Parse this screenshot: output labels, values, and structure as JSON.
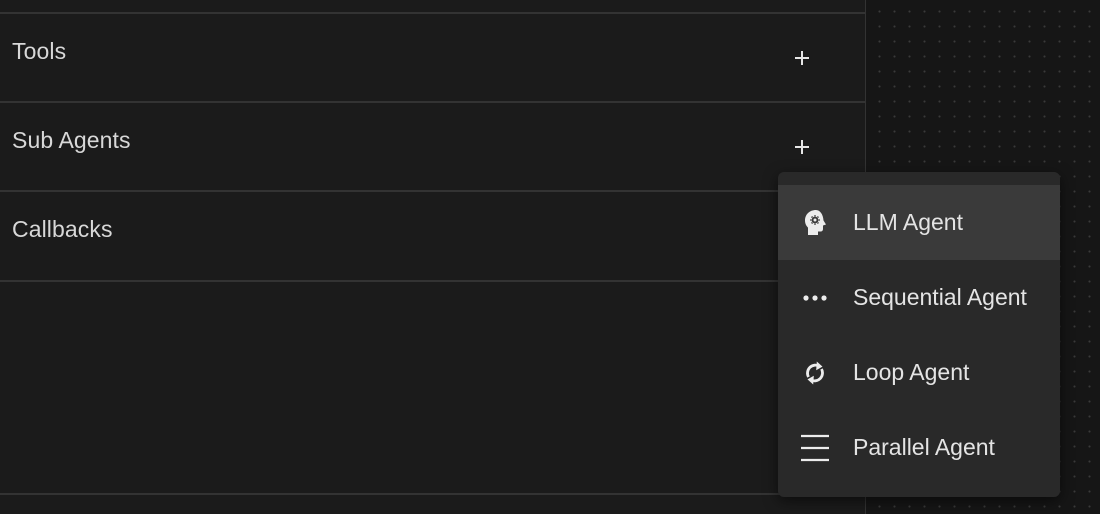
{
  "sections": {
    "tools": {
      "title": "Tools",
      "add_icon": "plus-icon"
    },
    "sub_agents": {
      "title": "Sub Agents",
      "add_icon": "plus-icon"
    },
    "callbacks": {
      "title": "Callbacks"
    }
  },
  "agent_menu": {
    "items": [
      {
        "label": "LLM Agent",
        "icon": "psychology-head-icon",
        "highlighted": true
      },
      {
        "label": "Sequential Agent",
        "icon": "more-horiz-icon",
        "highlighted": false
      },
      {
        "label": "Loop Agent",
        "icon": "loop-icon",
        "highlighted": false
      },
      {
        "label": "Parallel Agent",
        "icon": "parallel-lines-icon",
        "highlighted": false
      }
    ]
  },
  "colors": {
    "panel_bg": "#1b1b1b",
    "menu_bg": "#292929",
    "menu_highlight": "#3a3a3a",
    "text": "#e4e4e4",
    "divider": "#333333"
  }
}
